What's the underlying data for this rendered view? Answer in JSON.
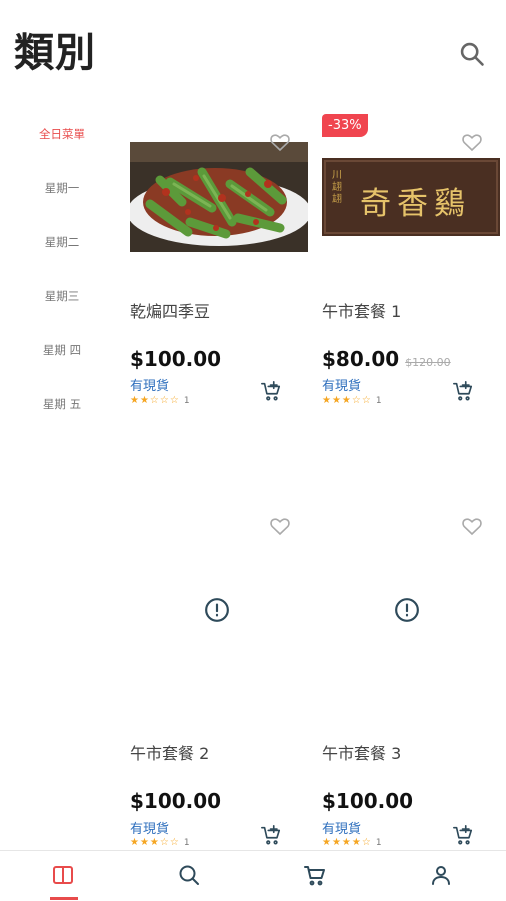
{
  "header": {
    "title": "類別"
  },
  "sidebar": {
    "items": [
      {
        "label": "全日菜單",
        "active": true
      },
      {
        "label": "星期一"
      },
      {
        "label": "星期二"
      },
      {
        "label": "星期三"
      },
      {
        "label": "星期 四"
      },
      {
        "label": "星期 五"
      }
    ]
  },
  "products": [
    {
      "name": "乾煸四季豆",
      "price": "$100.00",
      "stock": "有現貨",
      "stars": "★★☆☆☆",
      "reviews": "1"
    },
    {
      "name": "午市套餐 1",
      "price": "$80.00",
      "old_price": "$120.00",
      "badge": "-33%",
      "stock": "有現貨",
      "stars": "★★★☆☆",
      "reviews": "1",
      "sign_text": "奇香鷄",
      "sign_small": "川翃翃"
    },
    {
      "name": "午市套餐 2",
      "price": "$100.00",
      "stock": "有現貨",
      "stars": "★★★☆☆",
      "reviews": "1"
    },
    {
      "name": "午市套餐 3",
      "price": "$100.00",
      "stock": "有現貨",
      "stars": "★★★★☆",
      "reviews": "1"
    }
  ],
  "icons": {
    "search": "search-icon",
    "favorite": "heart-icon",
    "add_to_cart": "cart-plus-icon",
    "no_image": "alert-circle-icon",
    "tabs": [
      "book-icon",
      "search-icon",
      "cart-icon",
      "user-icon"
    ]
  },
  "colors": {
    "accent": "#e84b4b",
    "stock": "#2f6fbd",
    "star": "#f5a623",
    "icon": "#2e4a5a"
  }
}
